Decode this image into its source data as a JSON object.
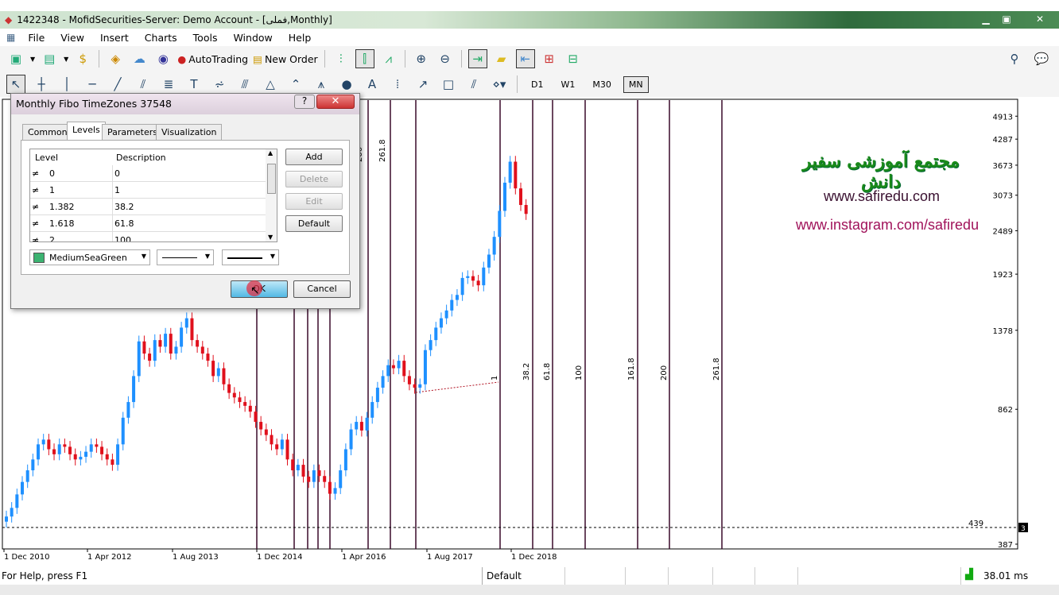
{
  "window": {
    "title": "1422348 - MofidSecurities-Server: Demo Account - [فملی,Monthly]"
  },
  "menu": [
    "File",
    "View",
    "Insert",
    "Charts",
    "Tools",
    "Window",
    "Help"
  ],
  "toolbar": {
    "autotrading_label": "AutoTrading",
    "new_order_label": "New Order"
  },
  "timeframes": [
    "D1",
    "W1",
    "M30",
    "MN"
  ],
  "active_timeframe": "MN",
  "dialog": {
    "title": "Monthly Fibo TimeZones 37548",
    "tabs": [
      "Common",
      "Levels",
      "Parameters",
      "Visualization"
    ],
    "active_tab": "Levels",
    "columns": [
      "Level",
      "Description"
    ],
    "levels": [
      {
        "level": "0",
        "description": "0"
      },
      {
        "level": "1",
        "description": "1"
      },
      {
        "level": "1.382",
        "description": "38.2"
      },
      {
        "level": "1.618",
        "description": "61.8"
      },
      {
        "level": "2",
        "description": "100"
      }
    ],
    "buttons": {
      "add": "Add",
      "delete": "Delete",
      "edit": "Edit",
      "default": "Default",
      "ok": "OK",
      "cancel": "Cancel"
    },
    "color_name": "MediumSeaGreen",
    "color_hex": "#3cb371"
  },
  "watermark": {
    "persian": "مجتمع آموزشی سفیر دانش",
    "site": "www.safiredu.com",
    "instagram": "www.instagram.com/safiredu"
  },
  "chart_data": {
    "type": "candlestick",
    "scale": "log",
    "price_ticks": [
      4913,
      4287,
      3673,
      3073,
      2489,
      1923,
      1378,
      862,
      387
    ],
    "date_ticks": [
      "1 Dec 2010",
      "1 Apr 2012",
      "1 Aug 2013",
      "1 Dec 2014",
      "1 Apr 2016",
      "1 Aug 2017",
      "1 Dec 2018"
    ],
    "start_month": "Dec 2010",
    "closes": [
      456,
      480,
      520,
      560,
      600,
      640,
      700,
      720,
      680,
      660,
      700,
      690,
      660,
      640,
      650,
      670,
      700,
      690,
      660,
      640,
      620,
      700,
      820,
      900,
      1050,
      1290,
      1200,
      1150,
      1300,
      1250,
      1350,
      1200,
      1250,
      1400,
      1480,
      1300,
      1250,
      1200,
      1150,
      1050,
      1100,
      1000,
      950,
      925,
      900,
      880,
      850,
      800,
      765,
      740,
      700,
      680,
      720,
      640,
      600,
      620,
      578,
      560,
      600,
      580,
      560,
      522,
      540,
      600,
      680,
      765,
      800,
      760,
      820,
      900,
      980,
      1050,
      1120,
      1100,
      1150,
      1050,
      1000,
      980,
      1000,
      1225,
      1300,
      1400,
      1480,
      1550,
      1650,
      1700,
      1880,
      1900,
      1850,
      1800,
      2000,
      2160,
      2400,
      2800,
      3310,
      3750,
      3200,
      2900,
      2750
    ],
    "up_color": "#1e90ff",
    "down_color": "#e0101c",
    "fibo_labels_upper": [
      "200",
      "261.8"
    ],
    "fibo_labels_lower": [
      "1",
      "38.2",
      "61.8",
      "100",
      "161.8",
      "200",
      "261.8"
    ],
    "horizontal_line": {
      "price_label": "439",
      "marker": "3"
    }
  },
  "status": {
    "help": "For Help, press F1",
    "profile": "Default",
    "ping": "38.01 ms"
  }
}
